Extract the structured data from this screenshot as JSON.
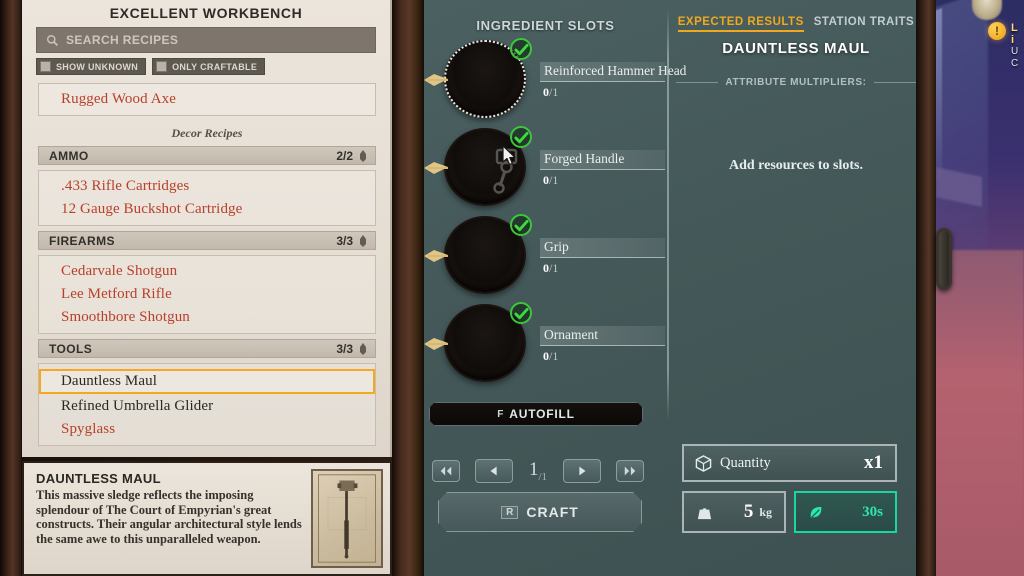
{
  "window": {
    "title": "EXCELLENT WORKBENCH"
  },
  "search": {
    "placeholder": "SEARCH RECIPES",
    "icon": "search-icon"
  },
  "filters": [
    {
      "label": "SHOW UNKNOWN",
      "checked": false
    },
    {
      "label": "ONLY CRAFTABLE",
      "checked": false
    }
  ],
  "recipe_list": {
    "top_recipes": [
      {
        "name": "Rugged Wood Axe",
        "known": false,
        "selected": false
      }
    ],
    "section_label": "Decor Recipes",
    "categories": [
      {
        "name": "AMMO",
        "count": "2/2",
        "icon": "category-icon",
        "items": [
          {
            "name": ".433 Rifle Cartridges",
            "known": false,
            "selected": false
          },
          {
            "name": "12 Gauge Buckshot Cartridge",
            "known": false,
            "selected": false
          }
        ]
      },
      {
        "name": "FIREARMS",
        "count": "3/3",
        "icon": "category-icon",
        "items": [
          {
            "name": "Cedarvale Shotgun",
            "known": false,
            "selected": false
          },
          {
            "name": "Lee Metford Rifle",
            "known": false,
            "selected": false
          },
          {
            "name": "Smoothbore Shotgun",
            "known": false,
            "selected": false
          }
        ]
      },
      {
        "name": "TOOLS",
        "count": "3/3",
        "icon": "category-icon",
        "items": [
          {
            "name": "Dauntless Maul",
            "known": true,
            "selected": true
          },
          {
            "name": "Refined Umbrella Glider",
            "known": true,
            "selected": false
          },
          {
            "name": "Spyglass",
            "known": false,
            "selected": false
          }
        ]
      }
    ]
  },
  "description": {
    "title": "DAUNTLESS MAUL",
    "body": "This massive sledge reflects the imposing splendour of The Court of Empyrian's great constructs. Their angular architectural style lends the same awe to this unparalleled weapon.",
    "thumbnail": "blueprint-sketch-maul"
  },
  "ingredients": {
    "heading": "INGREDIENT SLOTS",
    "slots": [
      {
        "name": "Reinforced Hammer Head",
        "count": "0",
        "required": "/1",
        "filled": false,
        "active": true,
        "icon": "empty-slot-icon"
      },
      {
        "name": "Forged Handle",
        "count": "0",
        "required": "/1",
        "filled": false,
        "active": false,
        "icon": "piston-rod-icon"
      },
      {
        "name": "Grip",
        "count": "0",
        "required": "/1",
        "filled": false,
        "active": false,
        "icon": "empty-slot-icon"
      },
      {
        "name": "Ornament",
        "count": "0",
        "required": "/1",
        "filled": false,
        "active": false,
        "icon": "empty-slot-icon"
      }
    ]
  },
  "actions": {
    "autofill": {
      "label": "AUTOFILL",
      "key": "F"
    },
    "craft": {
      "label": "CRAFT",
      "key": "R"
    },
    "stepper": {
      "first_icon": "double-left-icon",
      "prev_icon": "left-icon",
      "next_icon": "right-icon",
      "last_icon": "double-right-icon",
      "value": "1",
      "max": "/1"
    }
  },
  "results": {
    "tabs": [
      {
        "label": "EXPECTED RESULTS",
        "active": true
      },
      {
        "label": "STATION TRAITS",
        "active": false
      }
    ],
    "item_name": "DAUNTLESS MAUL",
    "attribute_divider_label": "ATTRIBUTE MULTIPLIERS:",
    "hint": "Add resources to slots."
  },
  "stats": {
    "quantity": {
      "label": "Quantity",
      "value": "x1",
      "icon": "box-icon"
    },
    "weight": {
      "value": "5",
      "unit": "kg",
      "icon": "weight-icon"
    },
    "time": {
      "value": "30s",
      "icon": "leaf-icon"
    }
  },
  "toast": {
    "badge": "!",
    "line1": "L",
    "line2": "i",
    "line3": "U",
    "line4": "C"
  },
  "colors": {
    "accent_gold": "#f0a91e",
    "recipe_unknown": "#b8402a",
    "panel_teal": "#44595a",
    "time_green": "#2ee6ad",
    "check_green": "#3cc63c"
  }
}
